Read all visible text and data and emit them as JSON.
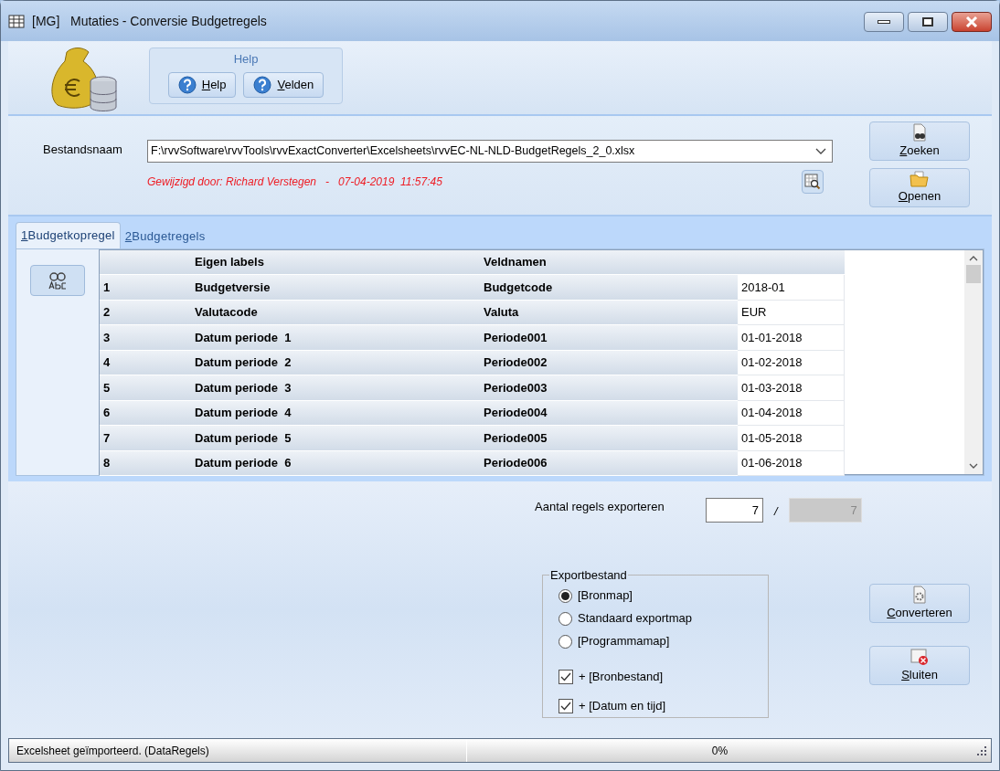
{
  "window": {
    "title": "[MG]   Mutaties - Conversie Budgetregels"
  },
  "help_group": {
    "title": "Help",
    "buttons": [
      "Help",
      "Velden"
    ]
  },
  "file": {
    "label": "Bestandsnaam",
    "value": "F:\\rvvSoftware\\rvvTools\\rvvExactConverter\\Excelsheets\\rvvEC-NL-NLD-BudgetRegels_2_0.xlsx",
    "modified": "Gewijzigd door: Richard Verstegen   -   07-04-2019  11:57:45",
    "buttons": [
      "Zoeken",
      "Openen"
    ]
  },
  "tabs": [
    {
      "number": "1",
      "label": "Budgetkopregel",
      "selected": true
    },
    {
      "number": "2",
      "label": "Budgetregels",
      "selected": false
    }
  ],
  "table": {
    "columns": [
      "Eigen labels",
      "Veldnamen"
    ],
    "rows": [
      {
        "number": "1",
        "label": "Budgetversie",
        "field": "Budgetcode",
        "value": "2018-01"
      },
      {
        "number": "2",
        "label": "Valutacode",
        "field": "Valuta",
        "value": "EUR"
      },
      {
        "number": "3",
        "label": "Datum periode  1",
        "field": "Periode001",
        "value": "01-01-2018"
      },
      {
        "number": "4",
        "label": "Datum periode  2",
        "field": "Periode002",
        "value": "01-02-2018"
      },
      {
        "number": "5",
        "label": "Datum periode  3",
        "field": "Periode003",
        "value": "01-03-2018"
      },
      {
        "number": "6",
        "label": "Datum periode  4",
        "field": "Periode004",
        "value": "01-04-2018"
      },
      {
        "number": "7",
        "label": "Datum periode  5",
        "field": "Periode005",
        "value": "01-05-2018"
      },
      {
        "number": "8",
        "label": "Datum periode  6",
        "field": "Periode006",
        "value": "01-06-2018"
      }
    ]
  },
  "export_count": {
    "label": "Aantal regels exporteren",
    "value": "7",
    "separator": "/",
    "total": "7"
  },
  "export_file": {
    "title": "Exportbestand",
    "options": [
      {
        "label": "[Bronmap]",
        "selected": true
      },
      {
        "label": "Standaard exportmap",
        "selected": false
      },
      {
        "label": "[Programmamap]",
        "selected": false
      }
    ],
    "checks": [
      {
        "label": "+ [Bronbestand]",
        "checked": true
      },
      {
        "label": "+ [Datum en tijd]",
        "checked": true
      }
    ]
  },
  "actions": [
    "Converteren",
    "Sluiten"
  ],
  "status_bar": {
    "message": "Excelsheet geïmporteerd. (DataRegels)",
    "progress": {
      "text": "0%",
      "level": 0
    }
  }
}
